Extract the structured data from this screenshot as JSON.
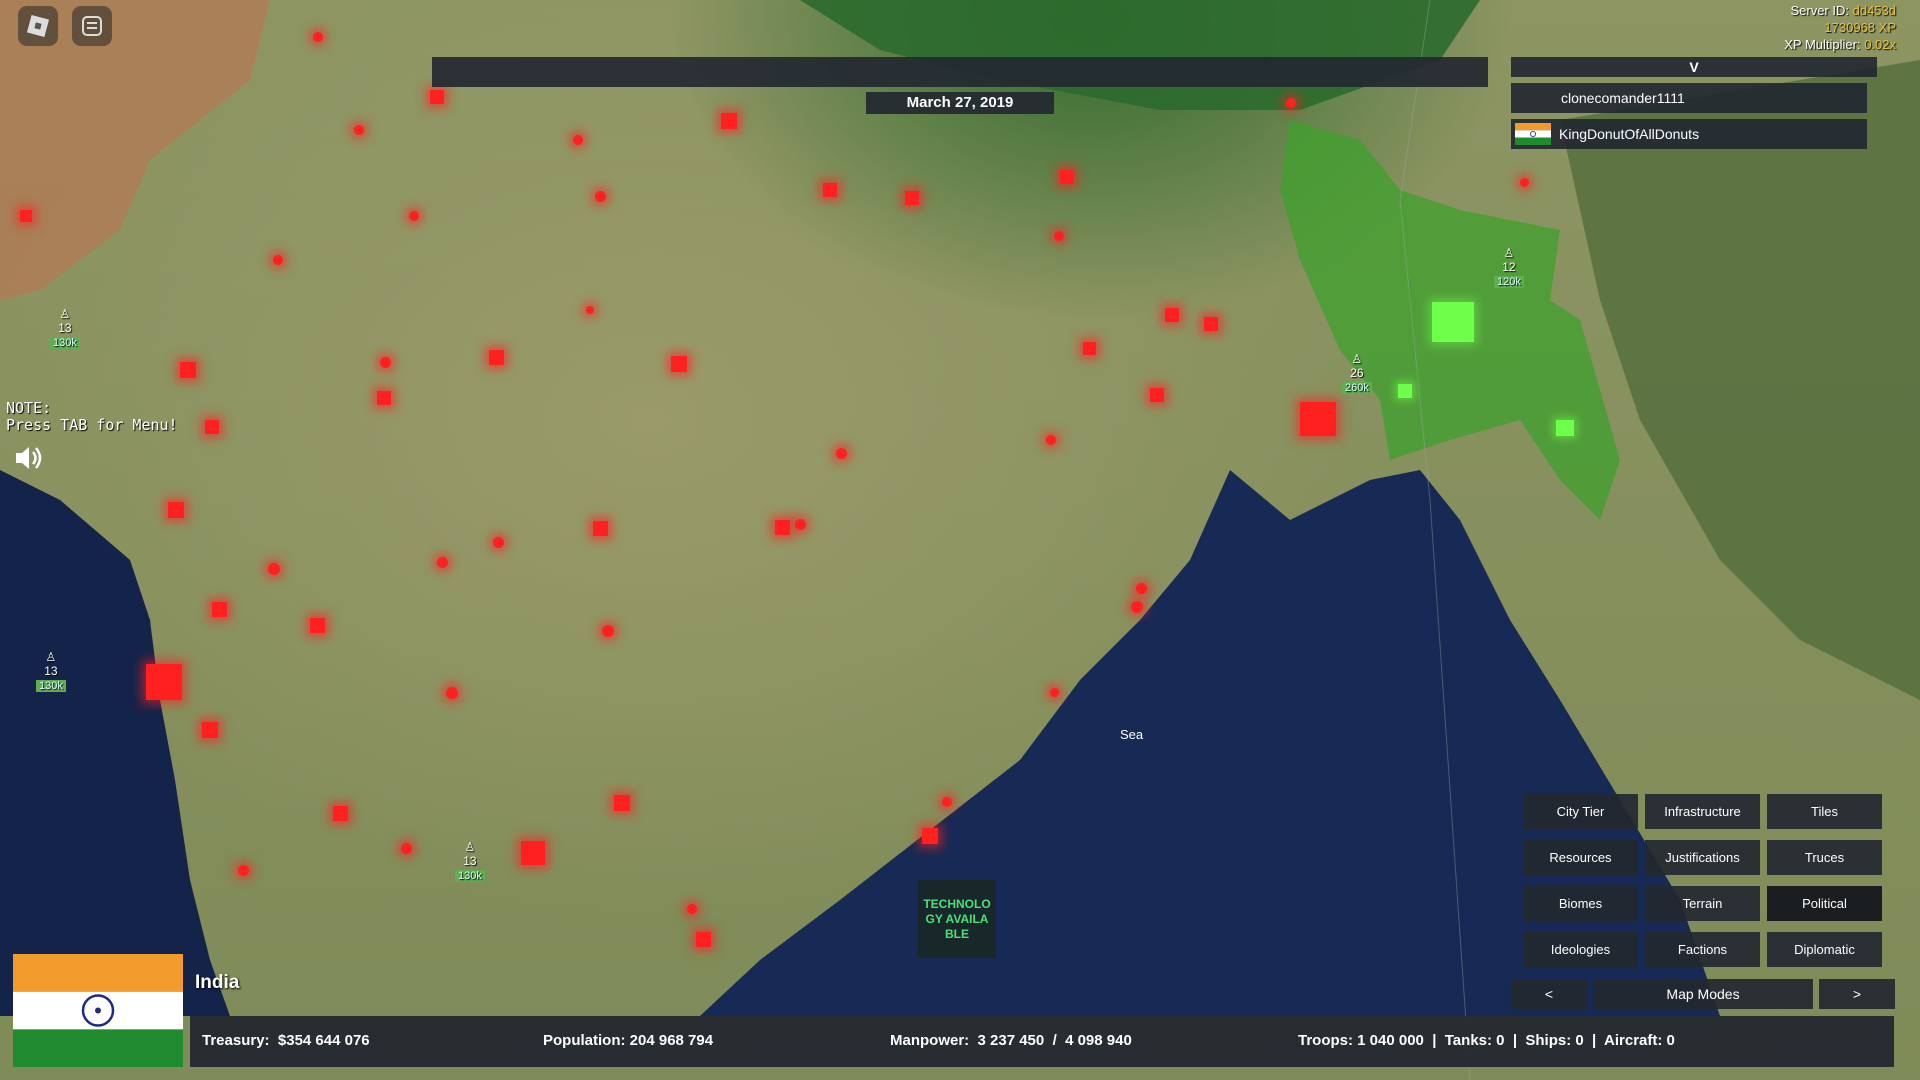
{
  "server": {
    "id_label": "Server ID:",
    "id_value": "dd453d",
    "xp_value": "1730968 XP",
    "multiplier_label": "XP Multiplier:",
    "multiplier_value": "0.02x"
  },
  "top_icons": [
    "roblox-logo-icon",
    "chat-menu-icon"
  ],
  "date": "March 27, 2019",
  "player_panel": {
    "header": "V",
    "players": [
      {
        "name": "clonecomander1111",
        "has_flag": false
      },
      {
        "name": "KingDonutOfAllDonuts",
        "has_flag": true
      }
    ]
  },
  "note": {
    "line1": "NOTE:",
    "line2": "Press TAB for Menu!"
  },
  "sea_label": "Sea",
  "tech_box": "TECHNOLOGY AVAILABLE",
  "map_modes": {
    "buttons": [
      {
        "label": "City Tier",
        "active": false
      },
      {
        "label": "Infrastructure",
        "active": false
      },
      {
        "label": "Tiles",
        "active": false
      },
      {
        "label": "Resources",
        "active": false
      },
      {
        "label": "Justifications",
        "active": false
      },
      {
        "label": "Truces",
        "active": false
      },
      {
        "label": "Biomes",
        "active": false
      },
      {
        "label": "Terrain",
        "active": false
      },
      {
        "label": "Political",
        "active": true
      },
      {
        "label": "Ideologies",
        "active": false
      },
      {
        "label": "Factions",
        "active": false
      },
      {
        "label": "Diplomatic",
        "active": false
      }
    ],
    "prev": "<",
    "title": "Map Modes",
    "next": ">"
  },
  "country": {
    "name": "India"
  },
  "stats": {
    "treasury_label": "Treasury:",
    "treasury_value": "$354 644 076",
    "population_label": "Population:",
    "population_value": "204 968 794",
    "manpower_label": "Manpower:",
    "manpower_value": "3 237 450  /  4 098 940",
    "troops_text": "Troops: 1 040 000  |  Tanks: 0  |  Ships: 0  |  Aircraft: 0"
  },
  "units": [
    {
      "count": "13",
      "strength": "130k"
    },
    {
      "count": "13",
      "strength": "130k"
    },
    {
      "count": "13",
      "strength": "130k"
    },
    {
      "count": "26",
      "strength": "260k"
    },
    {
      "count": "12",
      "strength": "120k"
    }
  ]
}
